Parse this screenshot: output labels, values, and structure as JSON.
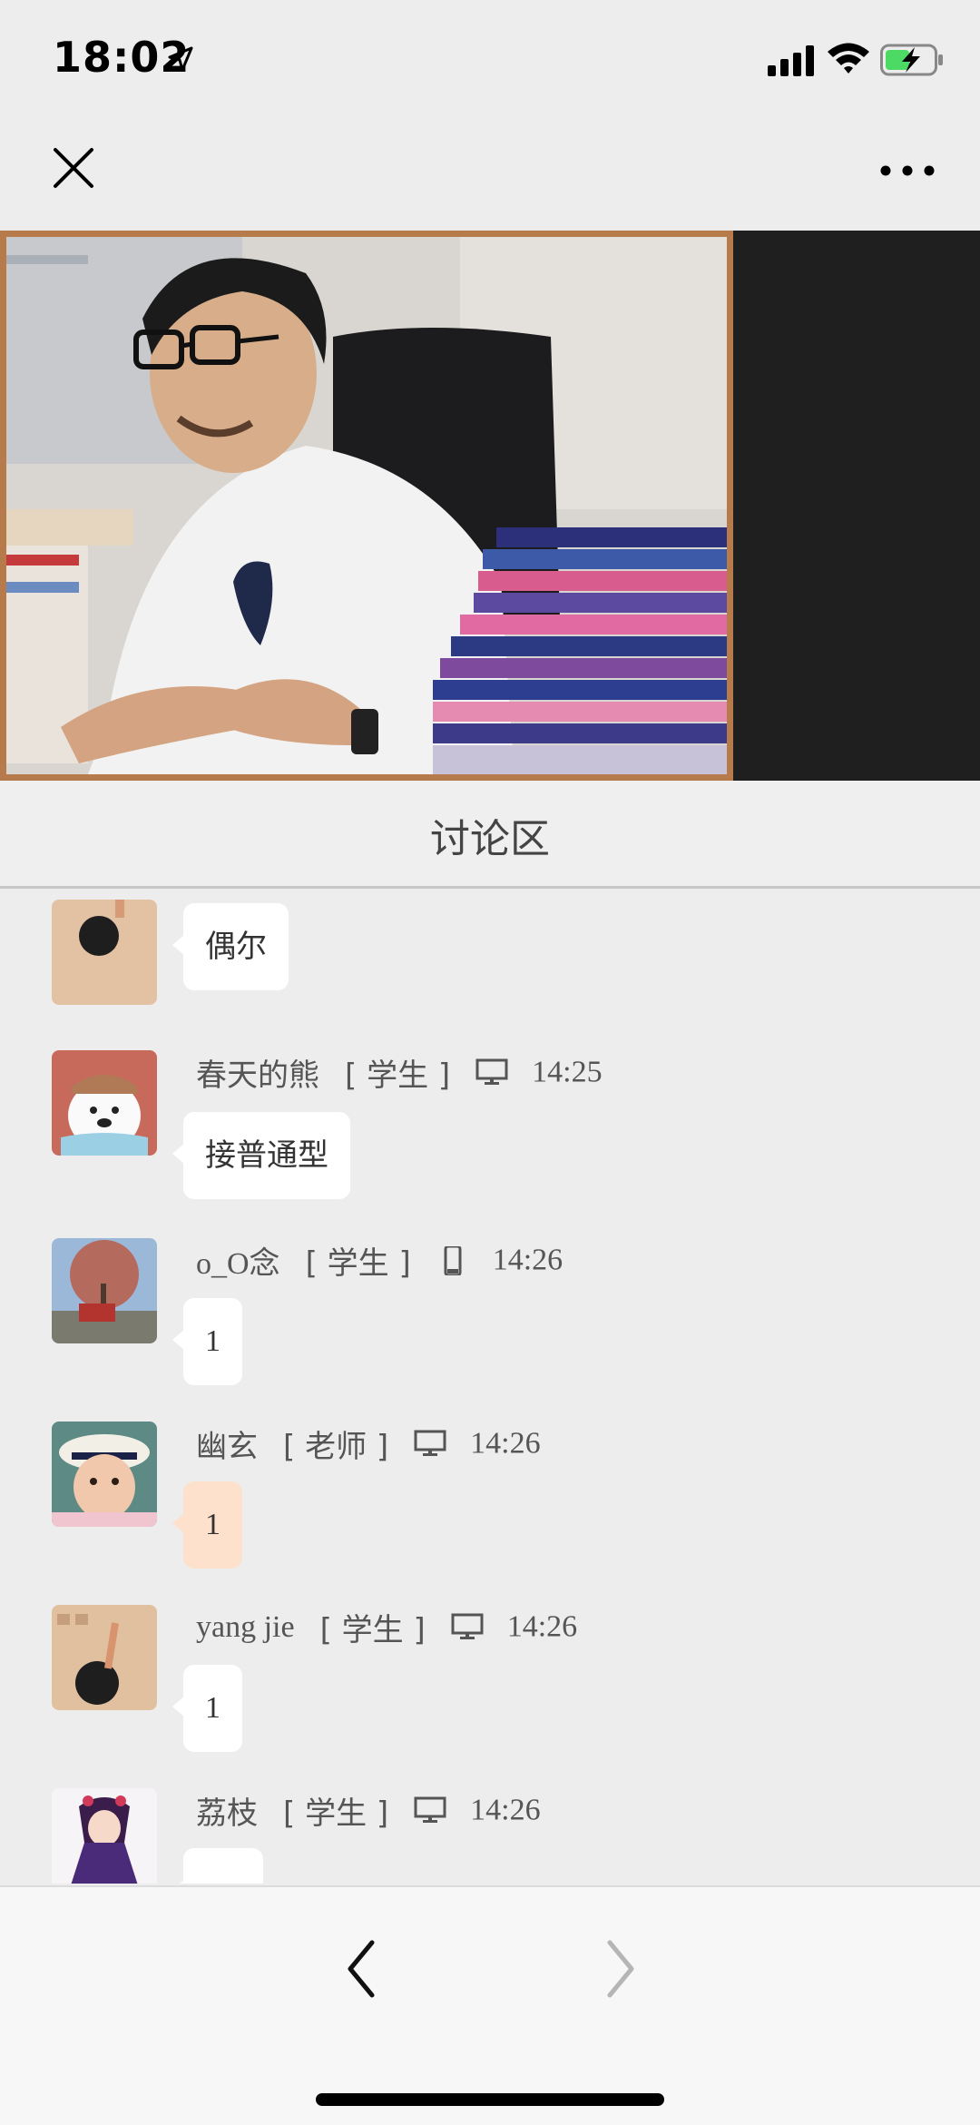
{
  "status_bar": {
    "time": "18:02"
  },
  "discussion": {
    "title": "讨论区"
  },
  "messages": [
    {
      "name": "",
      "role": "",
      "device": "",
      "time": "",
      "text": "偶尔",
      "avatar": "avatar-wall-toddler"
    },
    {
      "name": "春天的熊",
      "role": "[ 学生 ]",
      "device": "desktop-icon",
      "time": "14:25",
      "text": "接普通型",
      "avatar": "avatar-polar-bear"
    },
    {
      "name": "o_O念",
      "role": "[ 学生 ]",
      "device": "mobile-icon",
      "time": "14:26",
      "text": "1",
      "avatar": "avatar-street-tree"
    },
    {
      "name": "幽玄",
      "role": "[ 老师 ]",
      "device": "desktop-icon",
      "time": "14:26",
      "text": "1",
      "avatar": "avatar-baby-hat"
    },
    {
      "name": "yang jie",
      "role": "[ 学生 ]",
      "device": "desktop-icon",
      "time": "14:26",
      "text": "1",
      "avatar": "avatar-wall-toddler"
    },
    {
      "name": "荔枝",
      "role": "[ 学生 ]",
      "device": "desktop-icon",
      "time": "14:26",
      "text": "",
      "avatar": "avatar-anime-girl"
    }
  ],
  "colors": {
    "teacher_bubble": "#fde1cc",
    "video_border": "#b77a4a"
  }
}
